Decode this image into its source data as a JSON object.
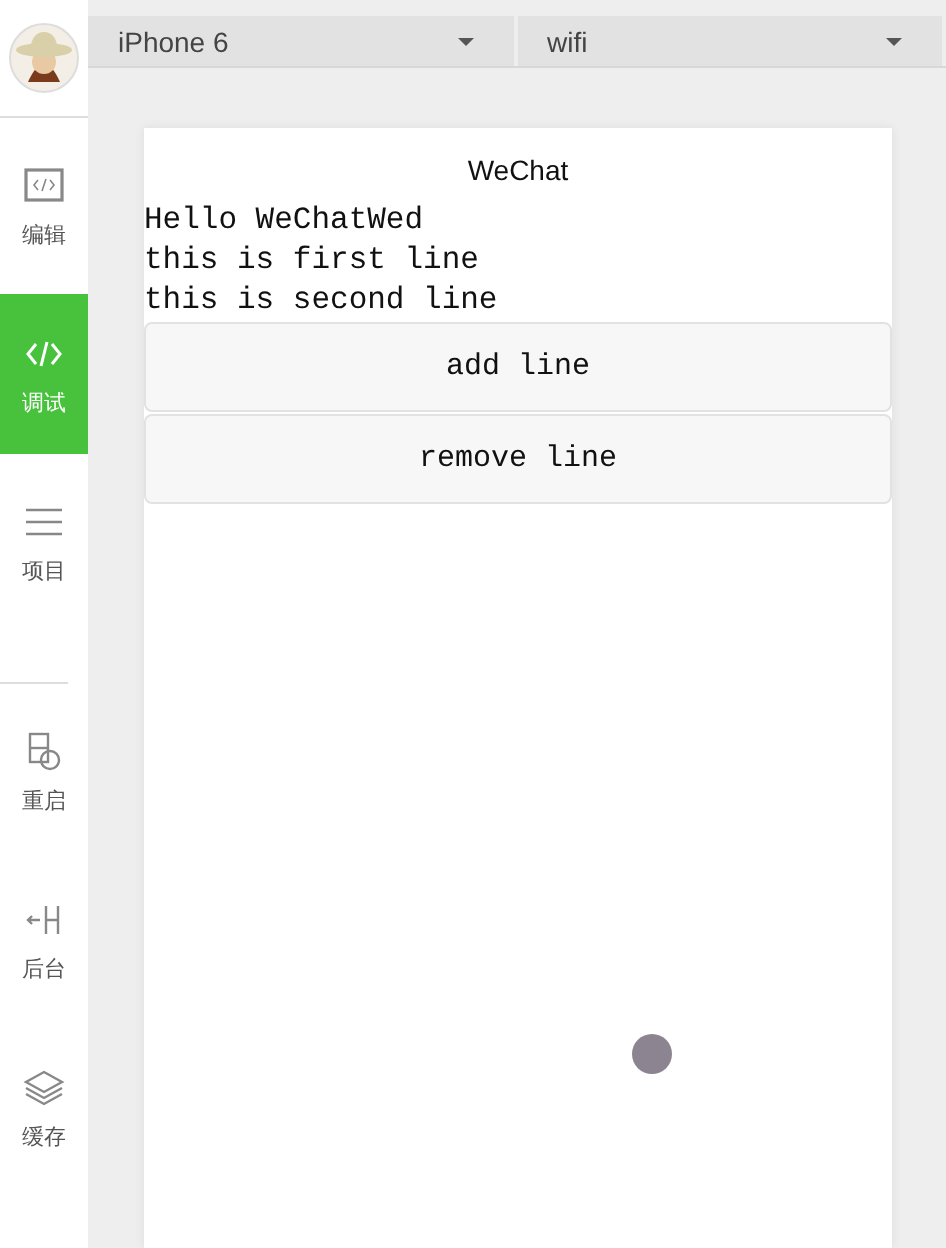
{
  "sidebar": {
    "items": [
      {
        "label": "编辑",
        "kind": "code-box",
        "selected": false
      },
      {
        "label": "调试",
        "kind": "code",
        "selected": true
      },
      {
        "label": "项目",
        "kind": "menu",
        "selected": false
      },
      {
        "kind": "divider"
      },
      {
        "label": "重启",
        "kind": "restart",
        "selected": false
      },
      {
        "label": "后台",
        "kind": "background",
        "selected": false
      },
      {
        "label": "缓存",
        "kind": "layers",
        "selected": false
      }
    ]
  },
  "toolbar": {
    "device": "iPhone 6",
    "network": "wifi"
  },
  "phone": {
    "title": "WeChat",
    "lines": [
      "Hello WeChatWed",
      "this is first line",
      "this is second line"
    ],
    "buttons": [
      "add line",
      "remove line"
    ]
  }
}
